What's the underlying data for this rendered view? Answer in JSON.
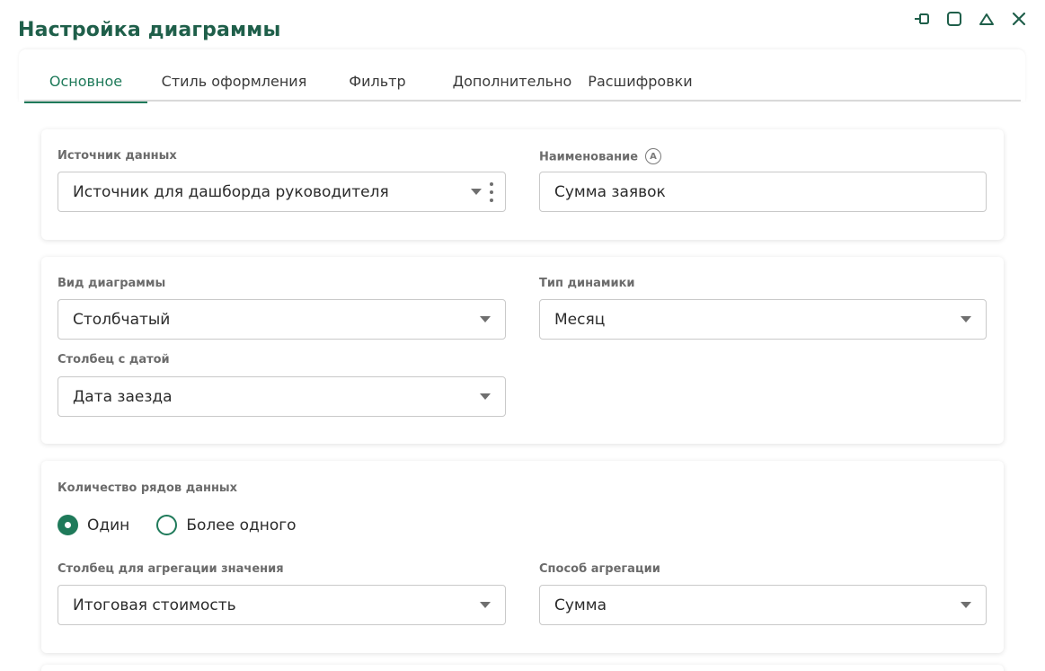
{
  "window": {
    "title": "Настройка диаграммы",
    "controls": [
      "pin-icon",
      "maximize-icon",
      "collapse-icon",
      "close-icon"
    ]
  },
  "tabs": [
    {
      "label": "Основное",
      "active": true
    },
    {
      "label": "Стиль оформления",
      "active": false
    },
    {
      "label": "Фильтр",
      "active": false
    },
    {
      "label": "Дополнительно",
      "active": false
    },
    {
      "label": "Расшифровки",
      "active": false
    }
  ],
  "source_card": {
    "source_label": "Источник данных",
    "source_value": "Источник для дашборда руководителя",
    "name_label": "Наименование",
    "name_info_icon": "A",
    "name_value": "Сумма заявок"
  },
  "chart_card": {
    "chart_type_label": "Вид диаграммы",
    "chart_type_value": "Столбчатый",
    "dynamics_label": "Тип динамики",
    "dynamics_value": "Месяц",
    "date_column_label": "Столбец с датой",
    "date_column_value": "Дата заезда"
  },
  "series_card": {
    "series_count_label": "Количество рядов данных",
    "options": [
      {
        "label": "Один",
        "checked": true
      },
      {
        "label": "Более одного",
        "checked": false
      }
    ],
    "agg_column_label": "Столбец для агрегации значения",
    "agg_column_value": "Итоговая стоимость",
    "agg_method_label": "Способ агрегации",
    "agg_method_value": "Сумма"
  },
  "colors": {
    "accent": "#1f7a5a",
    "title": "#1f5f4a",
    "border": "#c9c9c9"
  }
}
